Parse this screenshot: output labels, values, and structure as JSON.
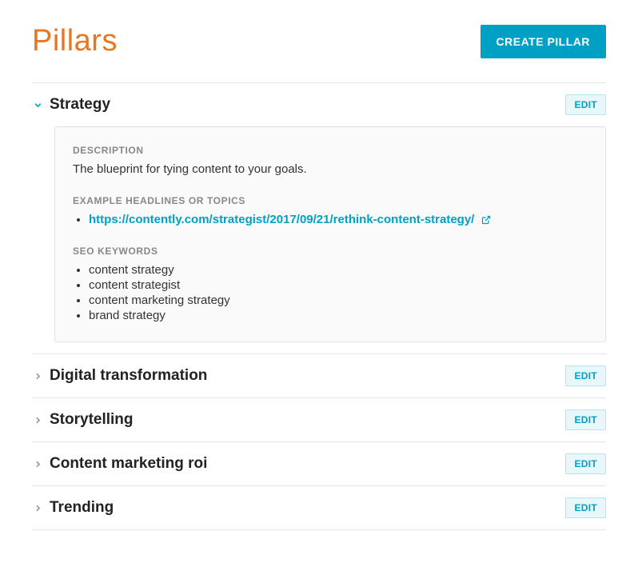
{
  "header": {
    "title": "Pillars",
    "create_label": "CREATE PILLAR"
  },
  "labels": {
    "edit": "EDIT",
    "description": "DESCRIPTION",
    "example_headlines": "EXAMPLE HEADLINES OR TOPICS",
    "seo_keywords": "SEO KEYWORDS"
  },
  "pillars": [
    {
      "title": "Strategy",
      "expanded": true,
      "description": "The blueprint for tying content to your goals.",
      "topics": [
        {
          "url": "https://contently.com/strategist/2017/09/21/rethink-content-strategy/"
        }
      ],
      "keywords": [
        "content strategy",
        "content strategist",
        "content marketing strategy",
        "brand strategy"
      ]
    },
    {
      "title": "Digital transformation",
      "expanded": false
    },
    {
      "title": "Storytelling",
      "expanded": false
    },
    {
      "title": "Content marketing roi",
      "expanded": false
    },
    {
      "title": "Trending",
      "expanded": false
    }
  ]
}
